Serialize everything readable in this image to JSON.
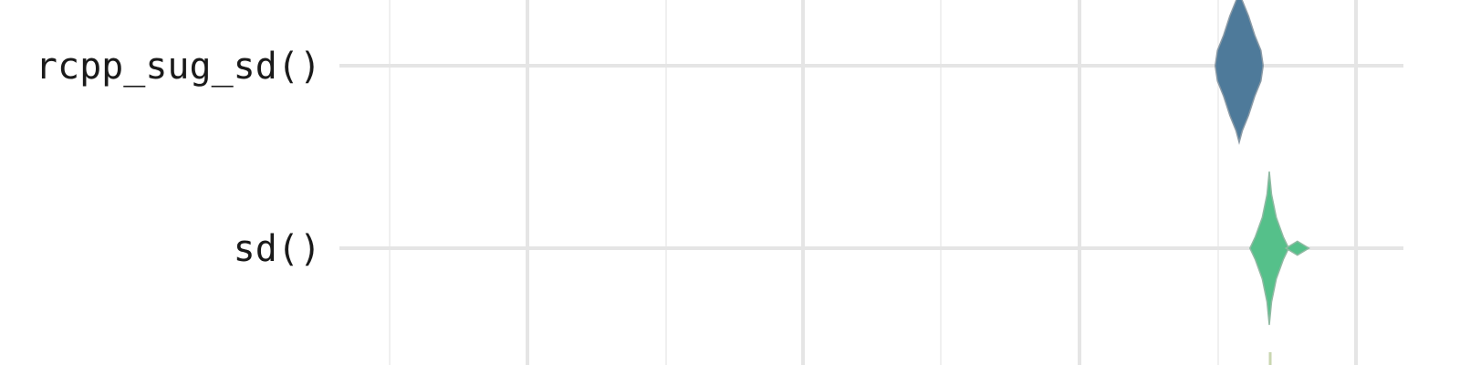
{
  "chart_data": {
    "type": "violin",
    "title": "",
    "xlabel": "",
    "ylabel": "",
    "orientation": "horizontal",
    "grid": true,
    "legend": "none",
    "categories": [
      "rcpp_sug_sd()",
      "sd()"
    ],
    "series": [
      {
        "category": "rcpp_sug_sd()",
        "color": "#4e7a9a",
        "outline": "#8a9aa6",
        "profile": [
          [
            -0.4,
            0.0
          ],
          [
            -0.34,
            0.02
          ],
          [
            -0.26,
            0.06
          ],
          [
            -0.16,
            0.1
          ],
          [
            -0.08,
            0.14
          ],
          [
            0.0,
            0.155
          ],
          [
            0.08,
            0.14
          ],
          [
            0.16,
            0.1
          ],
          [
            0.26,
            0.06
          ],
          [
            0.34,
            0.02
          ],
          [
            0.4,
            0.0
          ]
        ]
      },
      {
        "category": "sd()",
        "color": "#55c08a",
        "outline": "#8fb9a2",
        "profile": [
          [
            -0.4,
            0.0
          ],
          [
            -0.28,
            0.015
          ],
          [
            -0.16,
            0.045
          ],
          [
            -0.06,
            0.09
          ],
          [
            0.0,
            0.125
          ],
          [
            0.06,
            0.09
          ],
          [
            0.16,
            0.045
          ],
          [
            0.28,
            0.015
          ],
          [
            0.4,
            0.0
          ]
        ],
        "secondary_peak": {
          "center_offset": 0.28,
          "half_width": 0.06,
          "thickness": 0.045
        }
      }
    ],
    "next_category_hint": true
  }
}
